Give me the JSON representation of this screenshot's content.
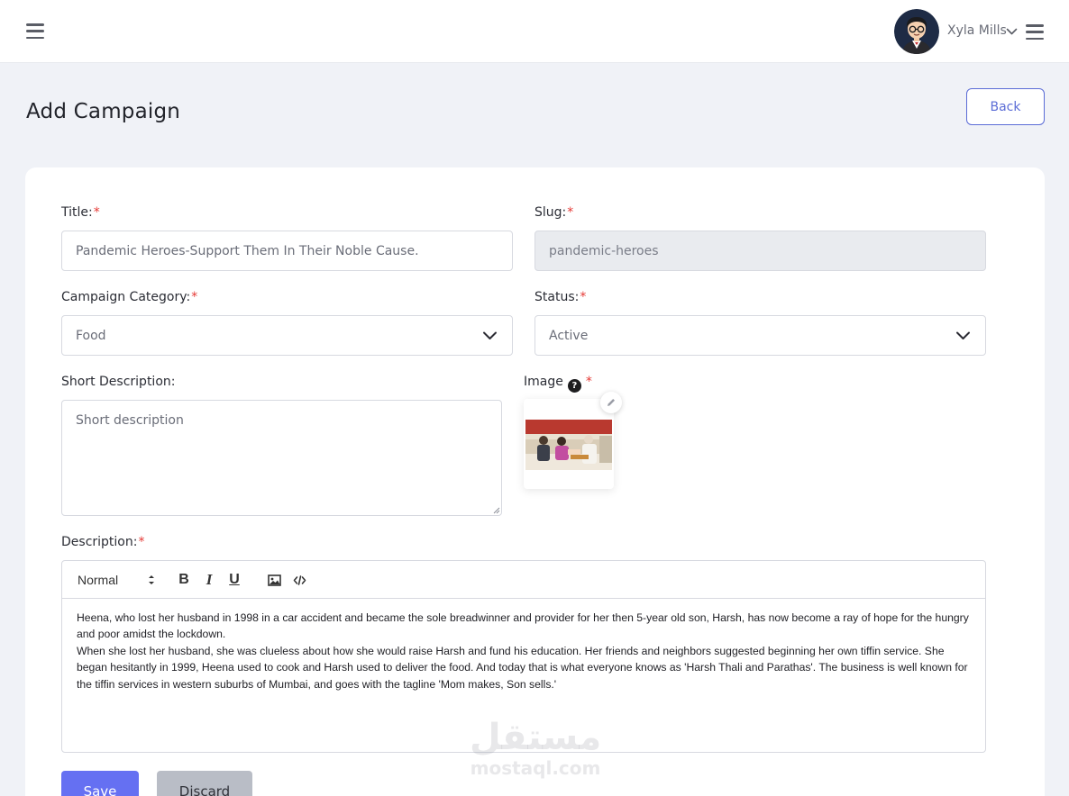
{
  "header": {
    "user_name": "Xyla Mills",
    "menu_icon": "hamburger-icon",
    "user_menu_icon": "chevron-down-icon",
    "right_menu_icon": "hamburger-icon"
  },
  "page": {
    "title": "Add Campaign",
    "back_label": "Back"
  },
  "form": {
    "title": {
      "label": "Title:",
      "required": "*",
      "value": "Pandemic Heroes-Support Them In Their Noble Cause."
    },
    "slug": {
      "label": "Slug:",
      "required": "*",
      "value": "pandemic-heroes"
    },
    "category": {
      "label": "Campaign Category:",
      "required": "*",
      "value": "Food"
    },
    "status": {
      "label": "Status:",
      "required": "*",
      "value": "Active"
    },
    "short_description": {
      "label": "Short Description:",
      "placeholder": "Short description"
    },
    "image": {
      "label": "Image",
      "help": "?",
      "required": "*"
    },
    "description": {
      "label": "Description:",
      "required": "*",
      "toolbar": {
        "format": "Normal",
        "bold": "B",
        "italic": "I",
        "underline": "U"
      },
      "paragraphs": [
        "Heena, who lost her husband in 1998 in a car accident and became the sole breadwinner and provider for her then 5-year old son, Harsh, has now become a ray of hope for the hungry and poor amidst the lockdown.",
        "When she lost her husband, she was clueless about how she would raise Harsh and fund his education. Her friends and neighbors suggested beginning her own tiffin service. She began hesitantly in 1999, Heena used to cook and Harsh used to deliver the food. And today that is what everyone knows as 'Harsh Thali and Parathas'. The business is well known for the tiffin services in western suburbs of Mumbai, and goes with the tagline 'Mom makes, Son sells.'"
      ]
    }
  },
  "actions": {
    "save_label": "Save",
    "discard_label": "Discard"
  },
  "watermark": {
    "arabic": "مستقل",
    "latin": "mostaql.com"
  },
  "colors": {
    "primary": "#6570f2",
    "back_border": "#5b6cd6",
    "required": "#e53935",
    "page_bg": "#f0f2f7"
  }
}
